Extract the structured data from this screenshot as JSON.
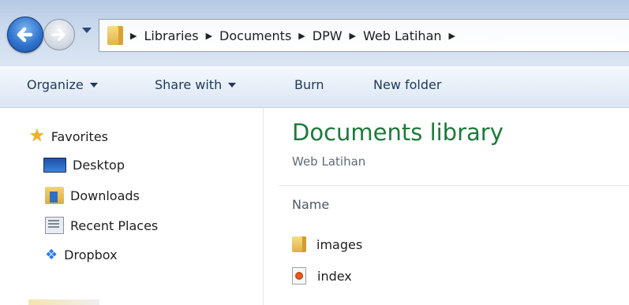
{
  "address": {
    "crumbs": [
      "Libraries",
      "Documents",
      "DPW",
      "Web Latihan"
    ]
  },
  "toolbar": {
    "organize": "Organize",
    "share_with": "Share with",
    "burn": "Burn",
    "new_folder": "New folder"
  },
  "nav": {
    "favorites": "Favorites",
    "items": [
      "Desktop",
      "Downloads",
      "Recent Places",
      "Dropbox"
    ]
  },
  "content": {
    "title": "Documents library",
    "subtitle": "Web Latihan",
    "column_name": "Name",
    "files": [
      "images",
      "index"
    ]
  },
  "colors": {
    "library_title": "#1e7a3a",
    "toolbar_text": "#1e395b"
  },
  "icons": [
    "back-icon",
    "forward-icon",
    "folder-icon",
    "star-icon",
    "desktop-icon",
    "downloads-icon",
    "recent-places-icon",
    "dropbox-icon",
    "html-file-icon"
  ]
}
